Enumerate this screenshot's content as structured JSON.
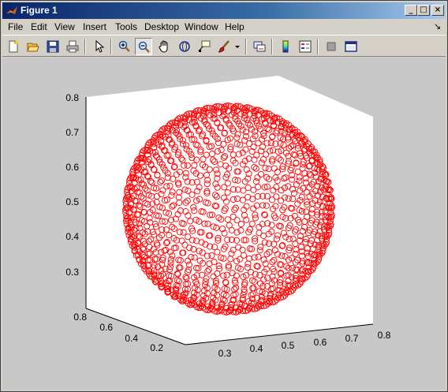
{
  "window": {
    "title": "Figure 1",
    "buttons": {
      "minimize": "_",
      "maximize": "□",
      "close": "×"
    }
  },
  "menubar": {
    "items": [
      "File",
      "Edit",
      "View",
      "Insert",
      "Tools",
      "Desktop",
      "Window",
      "Help"
    ],
    "overflow_arrow": "↘"
  },
  "toolbar": {
    "icons": [
      "new-figure-icon",
      "open-file-icon",
      "save-figure-icon",
      "print-figure-icon",
      "edit-plot-arrow-icon",
      "zoom-in-icon",
      "zoom-out-icon",
      "pan-hand-icon",
      "rotate-3d-icon",
      "data-cursor-icon",
      "brush-icon",
      "brush-dropdown-icon",
      "link-plot-icon",
      "insert-colorbar-icon",
      "insert-legend-icon",
      "hide-plot-tools-icon",
      "show-plot-tools-icon"
    ],
    "pressed": "zoom-out-icon"
  },
  "colors": {
    "marker": "#ff0000",
    "axes_background": "#ffffff",
    "figure_background": "#c8c8c8"
  },
  "chart_data": {
    "type": "scatter",
    "projection": "3d",
    "marker": "o",
    "marker_color": "red",
    "shape": "sphere",
    "center": [
      0.5,
      0.5,
      0.5
    ],
    "radius": 0.3,
    "x_ticks": [
      "0.3",
      "0.4",
      "0.5",
      "0.6",
      "0.7",
      "0.8"
    ],
    "y_ticks": [
      "0.2",
      "0.4",
      "0.6",
      "0.8"
    ],
    "z_ticks": [
      "0.3",
      "0.4",
      "0.5",
      "0.6",
      "0.7",
      "0.8"
    ],
    "xlim": [
      0.2,
      0.8
    ],
    "ylim": [
      0.2,
      0.8
    ],
    "zlim": [
      0.2,
      0.8
    ],
    "grid": false,
    "title": "",
    "xlabel": "",
    "ylabel": "",
    "zlabel": ""
  }
}
